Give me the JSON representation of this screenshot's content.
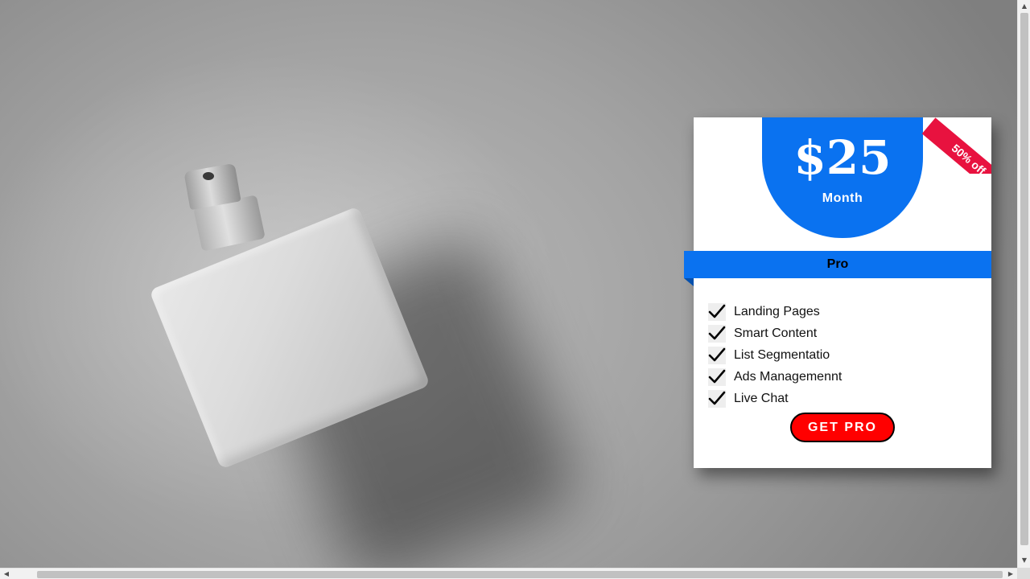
{
  "pricing_card": {
    "price": "$25",
    "period": "Month",
    "ribbon": "50% off",
    "plan_name": "Pro",
    "features": [
      "Landing Pages",
      "Smart Content",
      "List Segmentatio",
      "Ads Managemennt",
      "Live Chat"
    ],
    "cta_label": "GET PRO",
    "accent_color": "#0a72f0",
    "ribbon_color": "#e8123f",
    "cta_color": "#ff0000"
  },
  "background": {
    "image": "perfume-bottle-photo"
  },
  "icons": {
    "feature_marker": "checkmark-icon",
    "scroll_up": "scroll-up-arrow",
    "scroll_down": "scroll-down-arrow",
    "scroll_left": "scroll-left-arrow",
    "scroll_right": "scroll-right-arrow"
  }
}
